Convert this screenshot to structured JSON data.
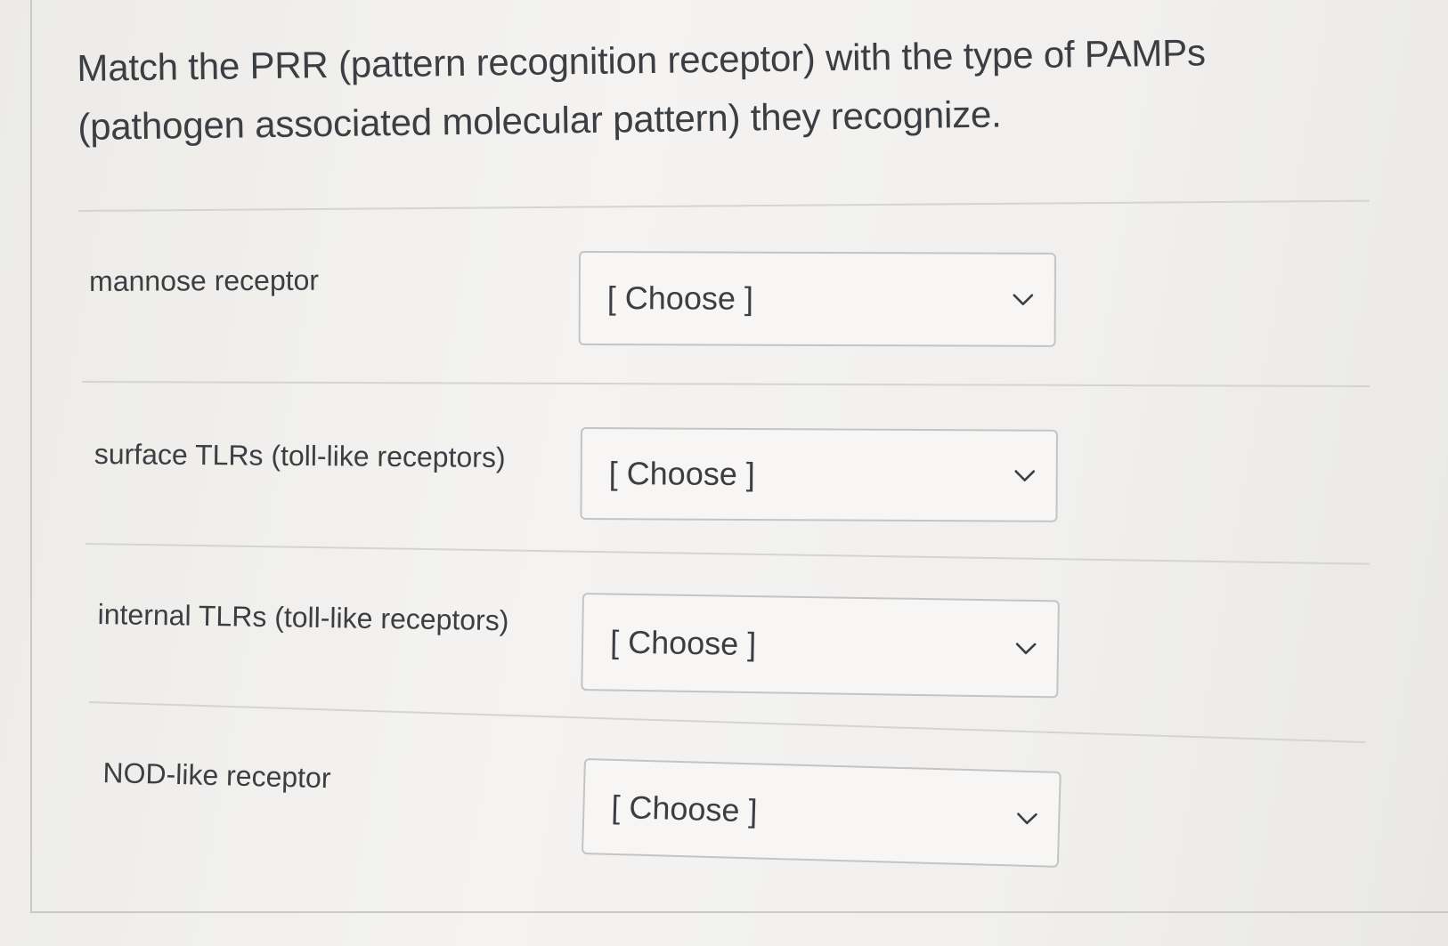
{
  "question": {
    "line1": "Match the PRR (pattern recognition receptor) with the type of PAMPs",
    "line2": "(pathogen associated molecular pattern) they recognize."
  },
  "rows": [
    {
      "label": "mannose receptor",
      "selected": "[ Choose ]"
    },
    {
      "label": "surface TLRs (toll-like receptors)",
      "selected": "[ Choose ]"
    },
    {
      "label": "internal TLRs (toll-like receptors)",
      "selected": "[ Choose ]"
    },
    {
      "label": "NOD-like receptor",
      "selected": "[ Choose ]"
    }
  ],
  "icons": {
    "dropdown": "chevron-down-icon"
  },
  "colors": {
    "text": "#3b3e42",
    "border": "#c3c4c6",
    "divider": "#d4d4d1"
  }
}
